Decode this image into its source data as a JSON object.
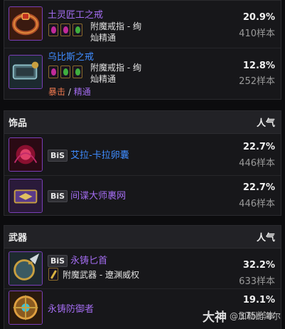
{
  "rings": {
    "items": [
      {
        "name": "土灵匠工之戒",
        "enchant_line1": "附魔戒指 - 绚",
        "enchant_line2": "灿精通",
        "pct": "20.9%",
        "samples": "410样本"
      },
      {
        "name": "乌比斯之戒",
        "enchant_line1": "附魔戒指 - 绚",
        "enchant_line2": "灿精通",
        "stat_crit": "暴击",
        "stat_sep": "/",
        "stat_mastery": "精通",
        "pct": "12.8%",
        "samples": "252样本"
      }
    ]
  },
  "trinkets": {
    "title": "饰品",
    "popularity_label": "人气",
    "items": [
      {
        "badge": "BiS",
        "name": "艾拉-卡拉卵囊",
        "pct": "22.7%",
        "samples": "446样本"
      },
      {
        "badge": "BiS",
        "name": "间谍大师裹网",
        "pct": "22.7%",
        "samples": "446样本"
      }
    ]
  },
  "weapons": {
    "title": "武器",
    "popularity_label": "人气",
    "items": [
      {
        "badge": "BiS",
        "name": "永铸匕首",
        "enchant": "附魔武器 - 遼渊威权",
        "pct": "32.2%",
        "samples": "633样本"
      },
      {
        "name": "永铸防御者",
        "pct": "19.1%",
        "samples": "375样本"
      }
    ]
  },
  "watermark": {
    "logo": "大神",
    "text": "@加勒比海尔"
  },
  "colors": {
    "epic": "#a36cf0",
    "rare_blue": "#3f8cff",
    "crit": "#f07a50",
    "gem_pink": "#c02a9a",
    "gem_green": "#3fae3f"
  }
}
